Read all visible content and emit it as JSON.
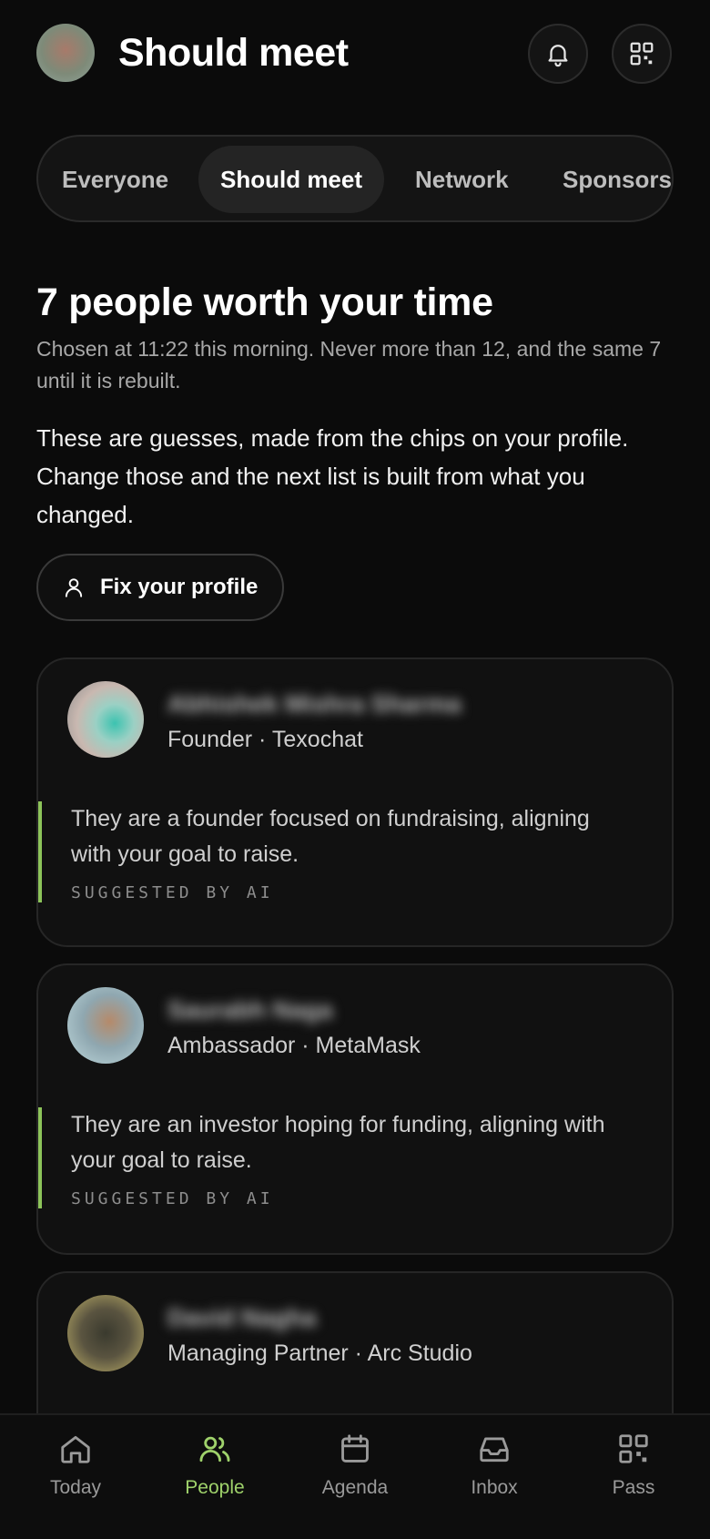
{
  "header": {
    "title": "Should meet",
    "avatar": "profile-avatar",
    "actions": [
      {
        "name": "notifications",
        "icon": "bell-icon"
      },
      {
        "name": "qr-code",
        "icon": "qr-code-icon"
      }
    ]
  },
  "tabs": [
    {
      "label": "Everyone",
      "active": false
    },
    {
      "label": "Should meet",
      "active": true
    },
    {
      "label": "Network",
      "active": false
    },
    {
      "label": "Sponsors",
      "active": false
    }
  ],
  "section": {
    "title": "7 people worth your time",
    "subtitle": "Chosen at 11:22 this morning. Never more than 12, and the same 7 until it is rebuilt.",
    "body": "These are guesses, made from the chips on your profile. Change those and the next list is built from what you changed.",
    "fix_button": {
      "label": "Fix your profile",
      "icon": "person-icon"
    }
  },
  "cards": [
    {
      "name": "Abhishek Mishra Sharma",
      "role": "Founder · Texochat",
      "reason": "They are a founder focused on fundraising, aligning with your goal to raise.",
      "tag": "SUGGESTED BY AI"
    },
    {
      "name": "Saurabh Naga",
      "role": "Ambassador · MetaMask",
      "reason": "They are an investor hoping for funding, aligning with your goal to raise.",
      "tag": "SUGGESTED BY AI"
    },
    {
      "name": "David Nagha",
      "role": "Managing Partner · Arc Studio",
      "reason": "",
      "tag": ""
    }
  ],
  "nav": [
    {
      "label": "Today",
      "icon": "home-icon",
      "active": false
    },
    {
      "label": "People",
      "icon": "people-icon",
      "active": true
    },
    {
      "label": "Agenda",
      "icon": "calendar-icon",
      "active": false
    },
    {
      "label": "Inbox",
      "icon": "inbox-icon",
      "active": false
    },
    {
      "label": "Pass",
      "icon": "qr-code-icon",
      "active": false
    }
  ],
  "colors": {
    "background": "#0b0b0b",
    "accent": "#9fd26b",
    "quote_bar": "#8dc45a",
    "card": "#111111"
  }
}
